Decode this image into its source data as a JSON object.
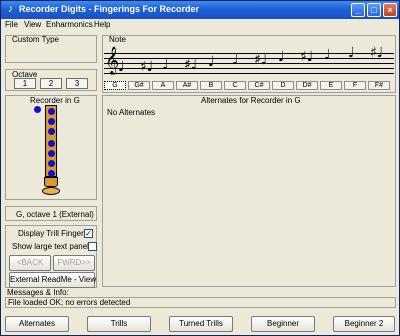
{
  "window": {
    "title": "Recorder Digits - Fingerings For Recorder"
  },
  "menu": [
    "File",
    "View",
    "Enharmonics",
    "Help"
  ],
  "left": {
    "custom_type_label": "Custom Type",
    "octave_label": "Octave",
    "octave_buttons": [
      "1",
      "2",
      "3"
    ],
    "recorder_label": "Recorder in G",
    "note_readout": "G, octave 1 (External)",
    "display_trill_label": "Display Trill Fingers",
    "show_large_text_label": "Show large text panel",
    "back_label": "<BACK",
    "forward_label": "FWRD>>",
    "readme_label": "External ReadMe - View"
  },
  "note_panel": {
    "label": "Note",
    "notes": [
      "G",
      "G#",
      "A",
      "A#",
      "B",
      "C",
      "C#",
      "D",
      "D#",
      "E",
      "F",
      "F#"
    ],
    "selected": "G"
  },
  "alternates": {
    "title": "Alternates for Recorder in G",
    "content": "No Alternates"
  },
  "messages": {
    "label": "Messages & Info:",
    "text": "File loaded OK; no errors detected"
  },
  "bottom_buttons": [
    "Alternates",
    "Trills",
    "Turned Trills",
    "Beginner",
    "Beginner 2"
  ],
  "colors": {
    "accent": "#1f5fd6",
    "hole": "#1010c8",
    "recorder": "#d99a30"
  }
}
